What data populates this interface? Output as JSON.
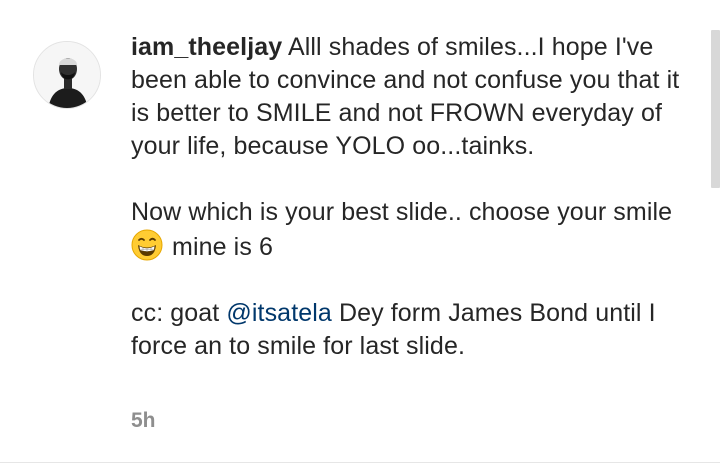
{
  "comment": {
    "username": "iam_theeljay",
    "paragraph1": "Alll shades of smiles...I hope I've been able to convince and not confuse you that it is better to SMILE and not FROWN everyday of your life, because YOLO oo...tainks.",
    "paragraph2_before_emoji": "Now which is your best slide.. choose your smile",
    "paragraph2_after_emoji": "mine is 6",
    "paragraph3_before_mention": "cc: goat",
    "mention": "@itsatela",
    "paragraph3_after_mention": "Dey form James Bond until I force an to smile for last slide.",
    "timestamp": "5h"
  },
  "icons": {
    "avatar": "profile-photo",
    "emoji": "grinning-face-with-smiling-eyes-emoji"
  },
  "colors": {
    "text": "#262626",
    "mention": "#00376b",
    "timestamp": "#8e8e8e"
  }
}
